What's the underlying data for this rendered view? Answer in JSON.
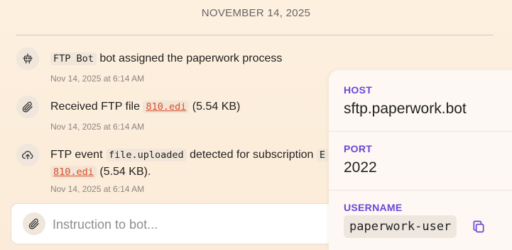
{
  "date_header": "NOVEMBER 14, 2025",
  "activities": [
    {
      "icon": "robot-icon",
      "bot_name": "FTP Bot",
      "text": "bot assigned the paperwork process",
      "time": "Nov 14, 2025 at 6:14 AM"
    },
    {
      "icon": "paperclip-icon",
      "text_before": "Received FTP file",
      "file": "810.edi",
      "size": "(5.54 KB)",
      "time": "Nov 14, 2025 at 6:14 AM"
    },
    {
      "icon": "cloud-upload-icon",
      "text_before": "FTP event",
      "event": "file.uploaded",
      "text_after": "detected for subscription",
      "subscription_partial": "E",
      "file": "810.edi",
      "size": "(5.54 KB).",
      "time": "Nov 14, 2025 at 6:14 AM"
    }
  ],
  "composer": {
    "placeholder": "Instruction to bot...",
    "attach_icon": "paperclip-icon"
  },
  "connection_panel": {
    "host_label": "HOST",
    "host_value": "sftp.paperwork.bot",
    "port_label": "PORT",
    "port_value": "2022",
    "username_label": "USERNAME",
    "username_value": "paperwork-user",
    "copy_icon": "copy-icon"
  },
  "colors": {
    "background": "#fdeedd",
    "label_accent": "#6a46d6",
    "file_link": "#d9502a"
  }
}
